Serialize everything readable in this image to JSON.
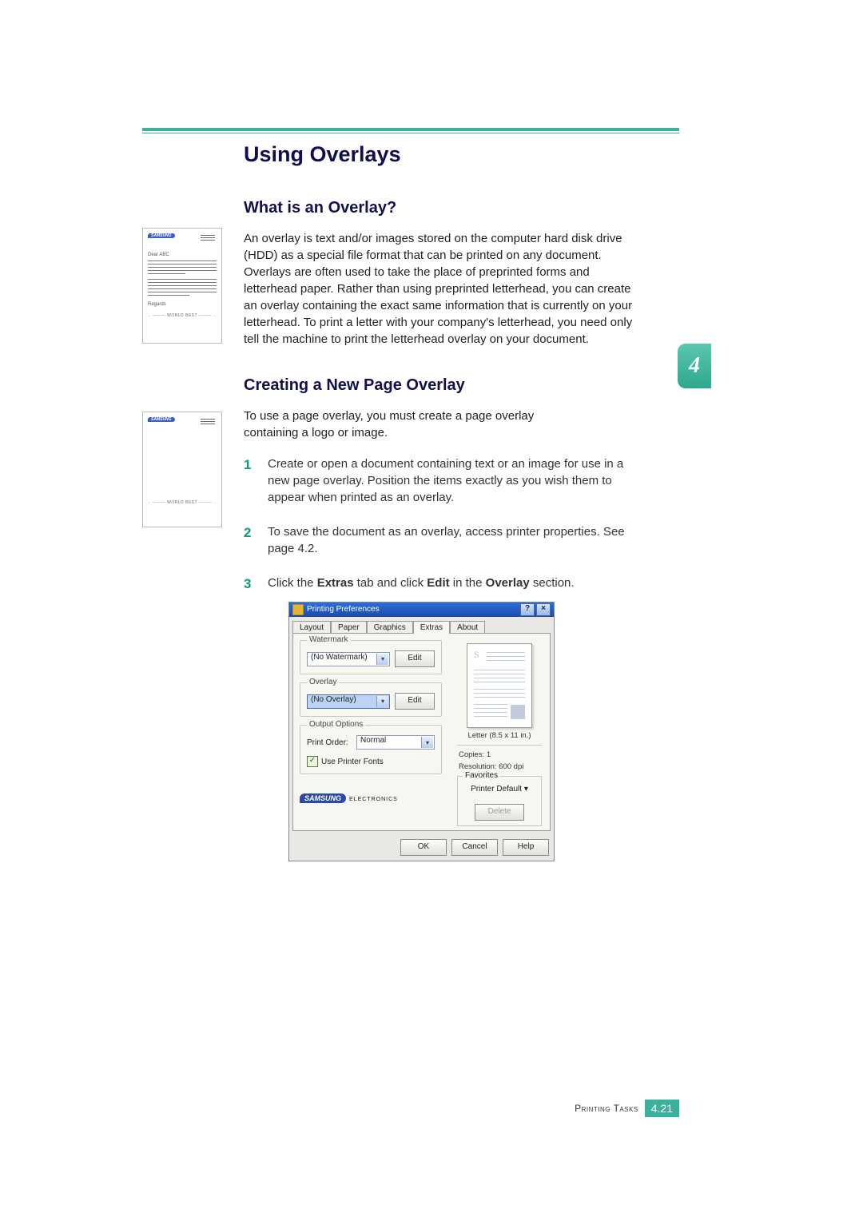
{
  "chapter_tab": "4",
  "top_illustration": {
    "brand": "SAMSUNG",
    "salutation": "Dear ABC",
    "closing": "Regards",
    "footer": "WORLD BEST"
  },
  "mid_illustration": {
    "brand": "SAMSUNG",
    "footer": "WORLD BEST"
  },
  "heading": "Using Overlays",
  "sub1": {
    "title": "What is an Overlay?",
    "para": "An overlay is text and/or images stored on the computer hard disk drive (HDD) as a special file format that can be printed on any document. Overlays are often used to take the place of preprinted forms and letterhead paper. Rather than using preprinted letterhead, you can create an overlay containing the exact same information that is currently on your letterhead. To print a letter with your company's letterhead, you need only tell the machine to print the letterhead overlay on your document."
  },
  "sub2": {
    "title": "Creating a New Page Overlay",
    "intro": "To use a page overlay, you must create a page overlay containing a logo or image.",
    "steps": [
      {
        "num": "1",
        "text": "Create or open a document containing text or an image for use in a new page overlay. Position the items exactly as you wish them to appear when printed as an overlay."
      },
      {
        "num": "2",
        "text": "To save the document as an overlay, access printer properties. See page 4.2."
      },
      {
        "num": "3",
        "pre": "Click the ",
        "b1": "Extras",
        "mid1": " tab and click ",
        "b2": "Edit",
        "mid2": " in the ",
        "b3": "Overlay",
        "post": " section."
      }
    ]
  },
  "dialog": {
    "title": "Printing Preferences",
    "help_btn": "?",
    "close_btn": "×",
    "tabs": {
      "layout": "Layout",
      "paper": "Paper",
      "graphics": "Graphics",
      "extras": "Extras",
      "about": "About"
    },
    "watermark": {
      "group": "Watermark",
      "value": "(No Watermark)",
      "edit": "Edit"
    },
    "overlay": {
      "group": "Overlay",
      "value": "(No Overlay)",
      "edit": "Edit"
    },
    "output": {
      "group": "Output Options",
      "print_order_label": "Print Order:",
      "print_order_value": "Normal",
      "use_printer_fonts": "Use Printer Fonts"
    },
    "preview": {
      "paper_label": "Letter (8.5 x 11 in.)",
      "copies": "Copies: 1",
      "resolution": "Resolution: 600 dpi"
    },
    "favorites": {
      "group": "Favorites",
      "value": "Printer Default",
      "delete": "Delete"
    },
    "brand": {
      "logo": "SAMSUNG",
      "sub": "ELECTRONICS"
    },
    "buttons": {
      "ok": "OK",
      "cancel": "Cancel",
      "help": "Help"
    }
  },
  "footer": {
    "section": "Printing Tasks",
    "page": "4.21"
  }
}
